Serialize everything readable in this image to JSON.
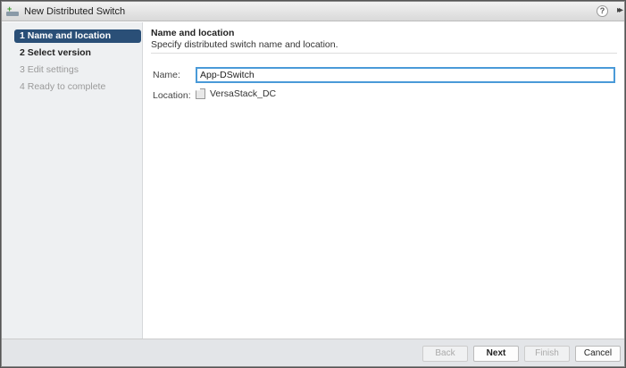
{
  "window": {
    "title": "New Distributed Switch",
    "help_label": "?",
    "expand_label": "▸▸"
  },
  "steps": [
    {
      "label": "1  Name and location",
      "state": "active"
    },
    {
      "label": "2  Select version",
      "state": "next"
    },
    {
      "label": "3  Edit settings",
      "state": "disabled"
    },
    {
      "label": "4  Ready to complete",
      "state": "disabled"
    }
  ],
  "page": {
    "title": "Name and location",
    "subtitle": "Specify distributed switch name and location.",
    "name_label": "Name:",
    "name_value": "App-DSwitch",
    "location_label": "Location:",
    "location_value": "VersaStack_DC"
  },
  "footer": {
    "back": "Back",
    "next": "Next",
    "finish": "Finish",
    "cancel": "Cancel"
  }
}
